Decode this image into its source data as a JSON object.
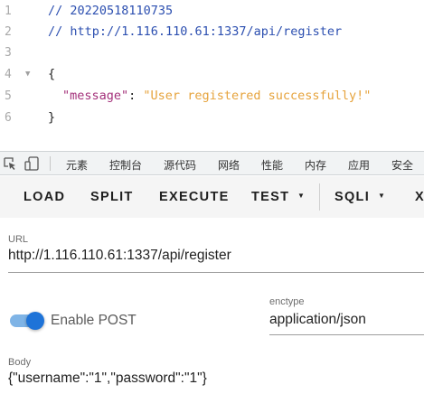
{
  "code_viewer": {
    "lines": [
      {
        "number": "1",
        "text": "// 20220518110735"
      },
      {
        "number": "2",
        "text": "// http://1.116.110.61:1337/api/register"
      },
      {
        "number": "3",
        "text": ""
      },
      {
        "number": "4",
        "text": "{"
      },
      {
        "number": "5",
        "key": "\"message\"",
        "colon": ": ",
        "value": "\"User registered successfully!\""
      },
      {
        "number": "6",
        "text": "}"
      }
    ],
    "fold_glyph": "▼"
  },
  "devtools": {
    "icons": [
      "inspect-element-icon",
      "device-toggle-icon"
    ],
    "tabs": [
      "元素",
      "控制台",
      "源代码",
      "网络",
      "性能",
      "内存",
      "应用",
      "安全"
    ]
  },
  "hackbar": {
    "buttons": {
      "load": "LOAD",
      "split": "SPLIT",
      "execute": "EXECUTE",
      "test": "TEST",
      "sqli": "SQLI",
      "overflow": "X"
    },
    "caret_glyph": "▼"
  },
  "form": {
    "url_label": "URL",
    "url_value": "http://1.116.110.61:1337/api/register",
    "enable_post_label": "Enable POST",
    "enable_post_checked": true,
    "enctype_label": "enctype",
    "enctype_value": "application/json",
    "body_label": "Body",
    "body_value": "{\"username\":\"1\",\"password\":\"1\"}"
  },
  "colors": {
    "comment": "#2c4fb0",
    "json_key": "#a3307a",
    "json_string": "#e6a33c",
    "switch_on": "#1e73d8"
  }
}
